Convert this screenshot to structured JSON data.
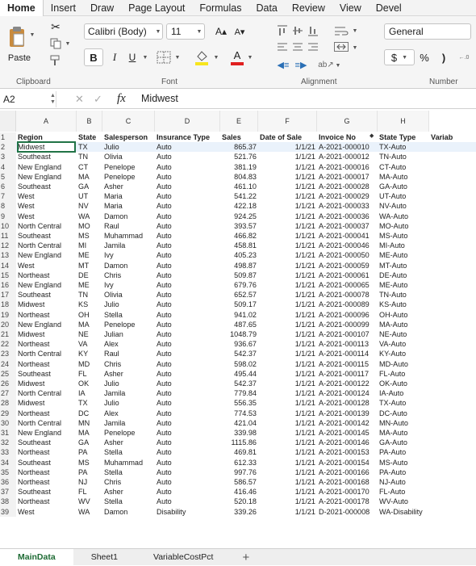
{
  "menu_tabs": [
    "Home",
    "Insert",
    "Draw",
    "Page Layout",
    "Formulas",
    "Data",
    "Review",
    "View",
    "Devel"
  ],
  "ribbon": {
    "paste": "Paste",
    "font_name": "Calibri (Body)",
    "font_size": "11",
    "grow_font": "A▴",
    "shrink_font": "A▾",
    "bold": "B",
    "italic": "I",
    "underline": "U",
    "font_color_label": "A",
    "number_format": "General",
    "currency": "$",
    "percent": "%",
    "comma": ")",
    "groups": [
      "Clipboard",
      "Font",
      "Alignment",
      "Number"
    ]
  },
  "formula_bar": {
    "name_box": "A2",
    "fx": "fx",
    "value": "Midwest"
  },
  "columns": [
    "A",
    "B",
    "C",
    "D",
    "E",
    "F",
    "G",
    "H"
  ],
  "headers": [
    "Region",
    "State",
    "Salesperson",
    "Insurance Type",
    "Sales",
    "Date of Sale",
    "Invoice No",
    "State Type",
    "Variab"
  ],
  "rows": [
    [
      "Midwest",
      "TX",
      "Julio",
      "Auto",
      "865.37",
      "1/1/21",
      "A-2021-000010",
      "TX-Auto"
    ],
    [
      "Southeast",
      "TN",
      "Olivia",
      "Auto",
      "521.76",
      "1/1/21",
      "A-2021-000012",
      "TN-Auto"
    ],
    [
      "New England",
      "CT",
      "Penelope",
      "Auto",
      "381.19",
      "1/1/21",
      "A-2021-000016",
      "CT-Auto"
    ],
    [
      "New England",
      "MA",
      "Penelope",
      "Auto",
      "804.83",
      "1/1/21",
      "A-2021-000017",
      "MA-Auto"
    ],
    [
      "Southeast",
      "GA",
      "Asher",
      "Auto",
      "461.10",
      "1/1/21",
      "A-2021-000028",
      "GA-Auto"
    ],
    [
      "West",
      "UT",
      "Maria",
      "Auto",
      "541.22",
      "1/1/21",
      "A-2021-000029",
      "UT-Auto"
    ],
    [
      "West",
      "NV",
      "Maria",
      "Auto",
      "422.18",
      "1/1/21",
      "A-2021-000033",
      "NV-Auto"
    ],
    [
      "West",
      "WA",
      "Damon",
      "Auto",
      "924.25",
      "1/1/21",
      "A-2021-000036",
      "WA-Auto"
    ],
    [
      "North Central",
      "MO",
      "Raul",
      "Auto",
      "393.57",
      "1/1/21",
      "A-2021-000037",
      "MO-Auto"
    ],
    [
      "Southeast",
      "MS",
      "Muhammad",
      "Auto",
      "466.82",
      "1/1/21",
      "A-2021-000041",
      "MS-Auto"
    ],
    [
      "North Central",
      "MI",
      "Jamila",
      "Auto",
      "458.81",
      "1/1/21",
      "A-2021-000046",
      "MI-Auto"
    ],
    [
      "New England",
      "ME",
      "Ivy",
      "Auto",
      "405.23",
      "1/1/21",
      "A-2021-000050",
      "ME-Auto"
    ],
    [
      "West",
      "MT",
      "Damon",
      "Auto",
      "498.87",
      "1/1/21",
      "A-2021-000059",
      "MT-Auto"
    ],
    [
      "Northeast",
      "DE",
      "Chris",
      "Auto",
      "509.87",
      "1/1/21",
      "A-2021-000061",
      "DE-Auto"
    ],
    [
      "New England",
      "ME",
      "Ivy",
      "Auto",
      "679.76",
      "1/1/21",
      "A-2021-000065",
      "ME-Auto"
    ],
    [
      "Southeast",
      "TN",
      "Olivia",
      "Auto",
      "652.57",
      "1/1/21",
      "A-2021-000078",
      "TN-Auto"
    ],
    [
      "Midwest",
      "KS",
      "Julio",
      "Auto",
      "509.17",
      "1/1/21",
      "A-2021-000089",
      "KS-Auto"
    ],
    [
      "Northeast",
      "OH",
      "Stella",
      "Auto",
      "941.02",
      "1/1/21",
      "A-2021-000096",
      "OH-Auto"
    ],
    [
      "New England",
      "MA",
      "Penelope",
      "Auto",
      "487.65",
      "1/1/21",
      "A-2021-000099",
      "MA-Auto"
    ],
    [
      "Midwest",
      "NE",
      "Julian",
      "Auto",
      "1048.79",
      "1/1/21",
      "A-2021-000107",
      "NE-Auto"
    ],
    [
      "Northeast",
      "VA",
      "Alex",
      "Auto",
      "936.67",
      "1/1/21",
      "A-2021-000113",
      "VA-Auto"
    ],
    [
      "North Central",
      "KY",
      "Raul",
      "Auto",
      "542.37",
      "1/1/21",
      "A-2021-000114",
      "KY-Auto"
    ],
    [
      "Northeast",
      "MD",
      "Chris",
      "Auto",
      "598.02",
      "1/1/21",
      "A-2021-000115",
      "MD-Auto"
    ],
    [
      "Southeast",
      "FL",
      "Asher",
      "Auto",
      "495.44",
      "1/1/21",
      "A-2021-000117",
      "FL-Auto"
    ],
    [
      "Midwest",
      "OK",
      "Julio",
      "Auto",
      "542.37",
      "1/1/21",
      "A-2021-000122",
      "OK-Auto"
    ],
    [
      "North Central",
      "IA",
      "Jamila",
      "Auto",
      "779.84",
      "1/1/21",
      "A-2021-000124",
      "IA-Auto"
    ],
    [
      "Midwest",
      "TX",
      "Julio",
      "Auto",
      "556.35",
      "1/1/21",
      "A-2021-000128",
      "TX-Auto"
    ],
    [
      "Northeast",
      "DC",
      "Alex",
      "Auto",
      "774.53",
      "1/1/21",
      "A-2021-000139",
      "DC-Auto"
    ],
    [
      "North Central",
      "MN",
      "Jamila",
      "Auto",
      "421.04",
      "1/1/21",
      "A-2021-000142",
      "MN-Auto"
    ],
    [
      "New England",
      "MA",
      "Penelope",
      "Auto",
      "339.98",
      "1/1/21",
      "A-2021-000145",
      "MA-Auto"
    ],
    [
      "Southeast",
      "GA",
      "Asher",
      "Auto",
      "1115.86",
      "1/1/21",
      "A-2021-000146",
      "GA-Auto"
    ],
    [
      "Northeast",
      "PA",
      "Stella",
      "Auto",
      "469.81",
      "1/1/21",
      "A-2021-000153",
      "PA-Auto"
    ],
    [
      "Southeast",
      "MS",
      "Muhammad",
      "Auto",
      "612.33",
      "1/1/21",
      "A-2021-000154",
      "MS-Auto"
    ],
    [
      "Northeast",
      "PA",
      "Stella",
      "Auto",
      "997.76",
      "1/1/21",
      "A-2021-000166",
      "PA-Auto"
    ],
    [
      "Northeast",
      "NJ",
      "Chris",
      "Auto",
      "586.57",
      "1/1/21",
      "A-2021-000168",
      "NJ-Auto"
    ],
    [
      "Southeast",
      "FL",
      "Asher",
      "Auto",
      "416.46",
      "1/1/21",
      "A-2021-000170",
      "FL-Auto"
    ],
    [
      "Northeast",
      "WV",
      "Stella",
      "Auto",
      "520.18",
      "1/1/21",
      "A-2021-000178",
      "WV-Auto"
    ],
    [
      "West",
      "WA",
      "Damon",
      "Disability",
      "339.26",
      "1/1/21",
      "D-2021-000008",
      "WA-Disability"
    ]
  ],
  "sheet_tabs": [
    "MainData",
    "Sheet1",
    "VariableCostPct"
  ],
  "add_sheet": "+"
}
